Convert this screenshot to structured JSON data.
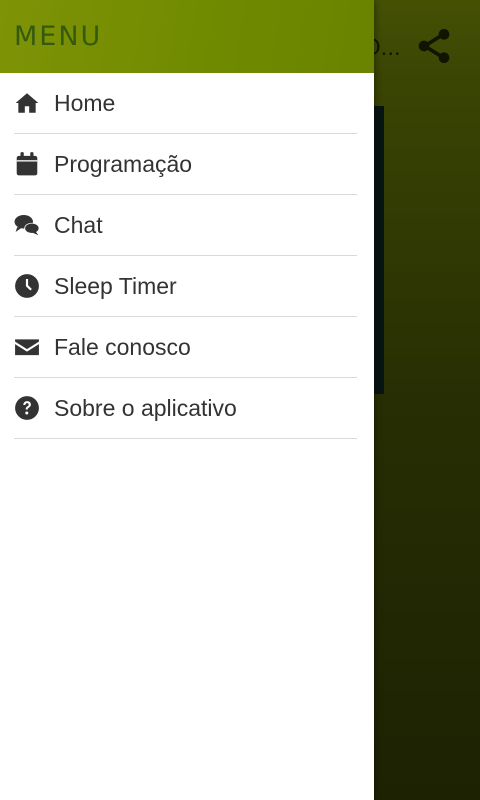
{
  "app": {
    "title_partial": "O...",
    "share_icon": "share-icon"
  },
  "drawer": {
    "title": "MENU",
    "items": [
      {
        "label": "Home",
        "icon": "home-icon"
      },
      {
        "label": "Programação",
        "icon": "calendar-icon"
      },
      {
        "label": "Chat",
        "icon": "chat-icon"
      },
      {
        "label": "Sleep Timer",
        "icon": "clock-icon"
      },
      {
        "label": "Fale conosco",
        "icon": "envelope-icon"
      },
      {
        "label": "Sobre o aplicativo",
        "icon": "question-circle-icon"
      }
    ]
  },
  "colors": {
    "header_accent": "#6f8a00",
    "text": "#333333",
    "menu_title": "#355a0d"
  }
}
